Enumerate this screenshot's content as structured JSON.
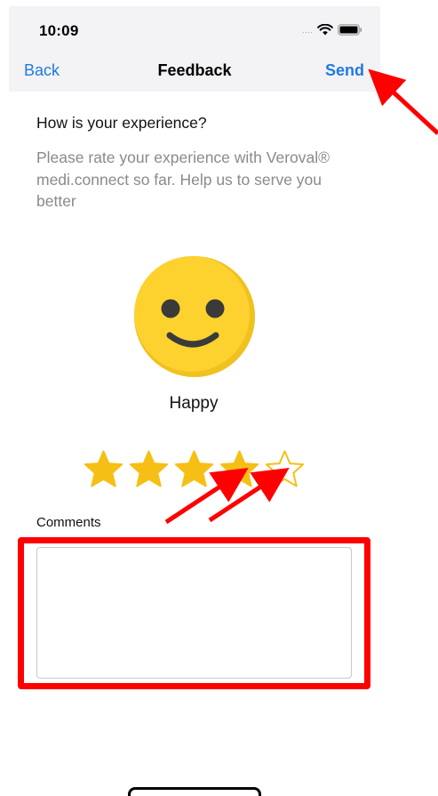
{
  "status_bar": {
    "time": "10:09",
    "signal_dots": "....",
    "icons": [
      "wifi-icon",
      "battery-icon"
    ]
  },
  "nav": {
    "back_label": "Back",
    "title": "Feedback",
    "send_label": "Send"
  },
  "content": {
    "question": "How is your experience?",
    "description": "Please rate your experience with Veroval® medi.connect so far. Help us to serve you better",
    "mood_icon": "smiley-face-icon",
    "mood_label": "Happy",
    "rating": {
      "value": 4,
      "max": 5
    },
    "comments_label": "Comments",
    "comments_value": ""
  },
  "annotations": {
    "arrow_color": "#ff0000",
    "highlight_color": "#ff0000",
    "targets": [
      "send-button",
      "star-4",
      "star-5",
      "comments-textarea"
    ]
  },
  "colors": {
    "accent": "#1f7ae0",
    "star_fill": "#f5bf15",
    "smiley": "#fdd22f",
    "secondary_text": "#8a8a8a"
  }
}
